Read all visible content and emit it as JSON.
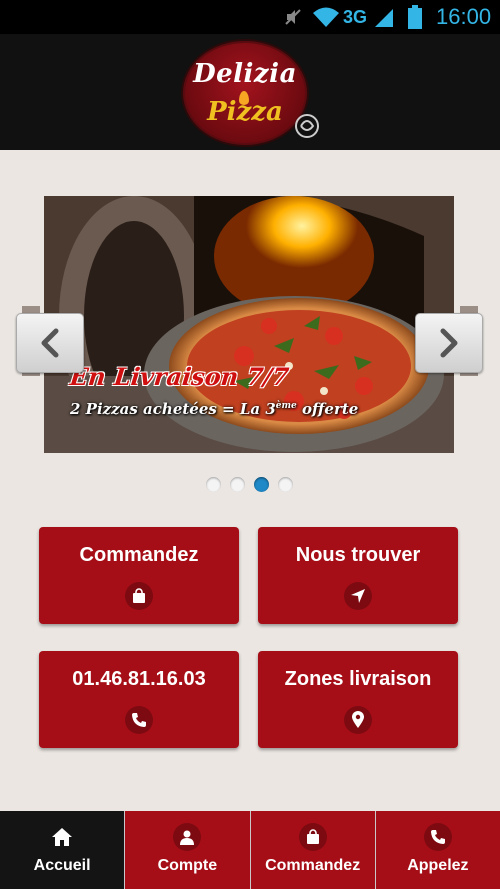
{
  "status_bar": {
    "network": "3G",
    "time": "16:00"
  },
  "header": {
    "logo_line1": "Delizia",
    "logo_line2": "Pizza"
  },
  "carousel": {
    "promo_title": "En Livraison 7/7",
    "promo_subtitle_main": "2 Pizzas achetées = La 3",
    "promo_subtitle_sup": "ème",
    "promo_subtitle_end": "offerte",
    "slide_count": 4,
    "active_slide": 3
  },
  "tiles": [
    {
      "label": "Commandez",
      "icon": "shopping-bag-icon"
    },
    {
      "label": "Nous trouver",
      "icon": "navigation-arrow-icon"
    },
    {
      "label": "01.46.81.16.03",
      "icon": "phone-icon"
    },
    {
      "label": "Zones livraison",
      "icon": "map-pin-icon"
    }
  ],
  "bottom_nav": [
    {
      "label": "Accueil",
      "icon": "home-icon",
      "active": true
    },
    {
      "label": "Compte",
      "icon": "user-icon",
      "active": false
    },
    {
      "label": "Commandez",
      "icon": "shopping-bag-icon",
      "active": false
    },
    {
      "label": "Appelez",
      "icon": "phone-icon",
      "active": false
    }
  ],
  "colors": {
    "brand_red": "#a50e17",
    "icon_circle": "#7d0a11",
    "active_dot": "#1f88c6",
    "status_blue": "#33b5e5"
  }
}
